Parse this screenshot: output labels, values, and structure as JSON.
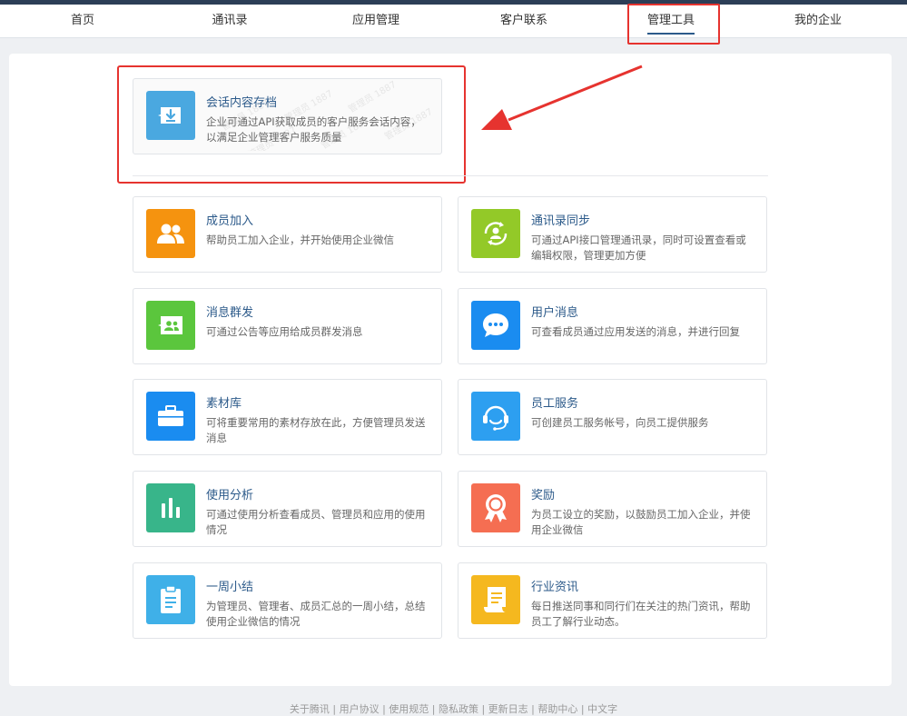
{
  "nav": {
    "items": [
      {
        "label": "首页"
      },
      {
        "label": "通讯录"
      },
      {
        "label": "应用管理"
      },
      {
        "label": "客户联系"
      },
      {
        "label": "管理工具"
      },
      {
        "label": "我的企业"
      }
    ],
    "active": "管理工具"
  },
  "featured": {
    "title": "会话内容存档",
    "desc": "企业可通过API获取成员的客户服务会话内容，以满足企业管理客户服务质量",
    "icon": "archive-download-icon",
    "color": "#4aa8e0"
  },
  "tools": [
    {
      "title": "成员加入",
      "desc": "帮助员工加入企业，并开始使用企业微信",
      "icon": "members-icon",
      "color": "#f5930f"
    },
    {
      "title": "通讯录同步",
      "desc": "可通过API接口管理通讯录，同时可设置查看或编辑权限，管理更加方便",
      "icon": "sync-contact-icon",
      "color": "#93c928"
    },
    {
      "title": "消息群发",
      "desc": "可通过公告等应用给成员群发消息",
      "icon": "broadcast-icon",
      "color": "#5bc63d"
    },
    {
      "title": "用户消息",
      "desc": "可查看成员通过应用发送的消息，并进行回复",
      "icon": "chat-bubble-icon",
      "color": "#1a8cf0"
    },
    {
      "title": "素材库",
      "desc": "可将重要常用的素材存放在此，方便管理员发送消息",
      "icon": "briefcase-icon",
      "color": "#1a8cf0"
    },
    {
      "title": "员工服务",
      "desc": "可创建员工服务帐号，向员工提供服务",
      "icon": "headset-icon",
      "color": "#2d9ff0"
    },
    {
      "title": "使用分析",
      "desc": "可通过使用分析查看成员、管理员和应用的使用情况",
      "icon": "bar-chart-icon",
      "color": "#38b58a"
    },
    {
      "title": "奖励",
      "desc": "为员工设立的奖励，以鼓励员工加入企业，并使用企业微信",
      "icon": "award-icon",
      "color": "#f56e52"
    },
    {
      "title": "一周小结",
      "desc": "为管理员、管理者、成员汇总的一周小结，总结使用企业微信的情况",
      "icon": "clipboard-icon",
      "color": "#3fb0e8"
    },
    {
      "title": "行业资讯",
      "desc": "每日推送同事和同行们在关注的热门资讯，帮助员工了解行业动态。",
      "icon": "news-scroll-icon",
      "color": "#f5b81f"
    }
  ],
  "footer": {
    "text": "关于腾讯 | 用户协议 | 使用规范 | 隐私政策 | 更新日志 | 帮助中心 | 中文字"
  },
  "colors": {
    "accent": "#2c5a8a",
    "annotation": "#e6332f"
  }
}
